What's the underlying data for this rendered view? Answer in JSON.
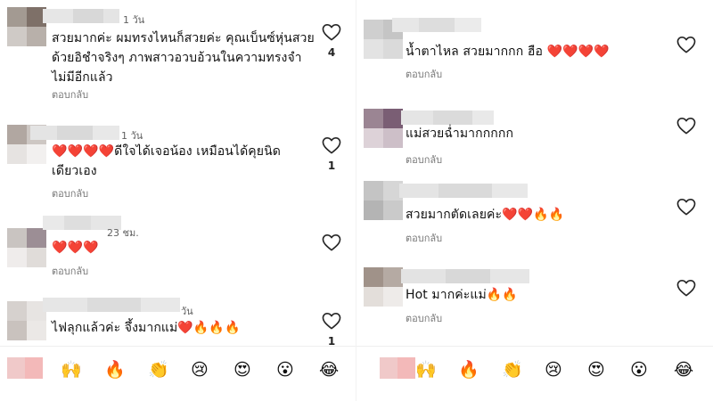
{
  "colors": {
    "heart_stroke": "#262626",
    "secondary_text": "#737373",
    "blur_gray": "#d9d9d9"
  },
  "left": {
    "comments": [
      {
        "time": "1 วัน",
        "text": "สวยมากค่ะ ผมทรงไหนก็สวยค่ะ  คุณเบ็นซ์หุ่นสวย\nด้วยอิชำจริงๆ ภาพสาวอวบอ้วนในความทรงจำ\nไม่มีอีกแล้ว",
        "reply": "ตอบกลับ",
        "likes": "4"
      },
      {
        "time": "1 วัน",
        "text": "❤️❤️❤️❤️ดีใจได้เจอน้อง  เหมือนได้คุยนิด\nเดียวเอง",
        "reply": "ตอบกลับ",
        "likes": "1"
      },
      {
        "time": "23 ชม.",
        "text": "❤️❤️❤️",
        "reply": "ตอบกลับ",
        "likes": ""
      },
      {
        "time": "วัน",
        "text": "ไฟลุกแล้วค่ะ จึ้งมากแม่❤️🔥🔥🔥",
        "reply": "",
        "likes": "1"
      }
    ]
  },
  "right": {
    "comments": [
      {
        "time": "",
        "text": "น้ำตาไหล สวยมากกก ฮือ ❤️❤️❤️❤️",
        "reply": "ตอบกลับ",
        "likes": ""
      },
      {
        "time": "",
        "text": "แม่สวยฉ่ำมากกกกก",
        "reply": "ตอบกลับ",
        "likes": ""
      },
      {
        "time": "",
        "text": "สวยมากตัดเลยค่ะ❤️❤️🔥🔥",
        "reply": "ตอบกลับ",
        "likes": ""
      },
      {
        "time": "",
        "text": "Hot มากค่ะแม่🔥🔥",
        "reply": "ตอบกลับ",
        "likes": ""
      }
    ]
  },
  "emoji_bar": {
    "emojis": [
      "🙌",
      "🔥",
      "👏",
      "😢",
      "😍",
      "😮",
      "😂"
    ]
  }
}
